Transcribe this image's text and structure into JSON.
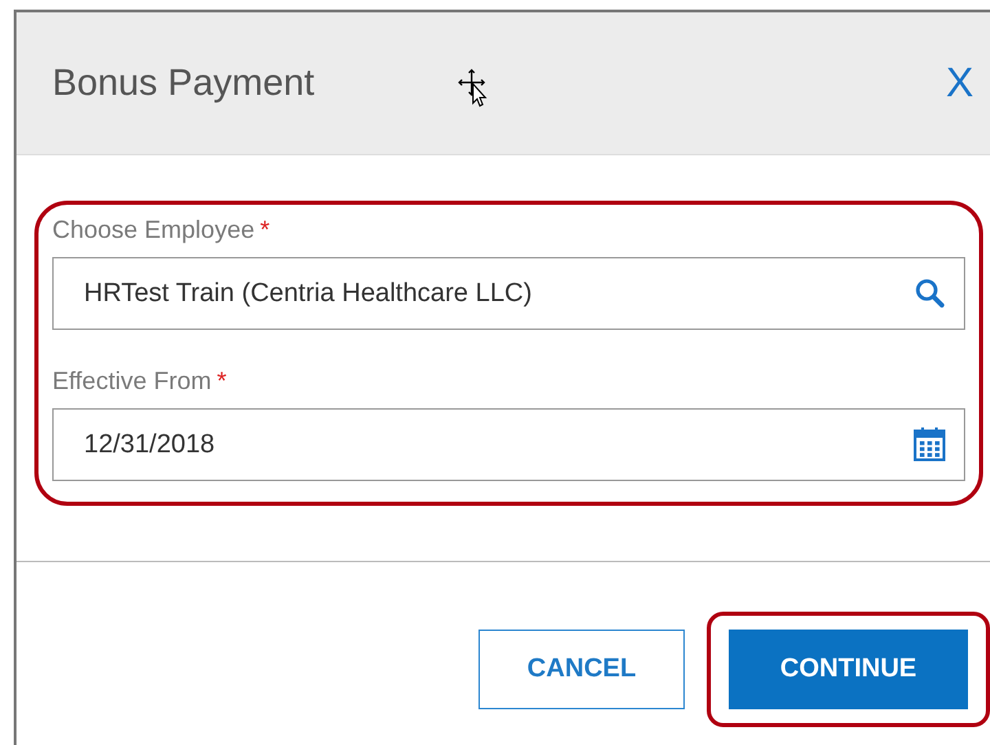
{
  "dialog": {
    "title": "Bonus Payment",
    "close_label": "X"
  },
  "form": {
    "highlighted": true,
    "fields": [
      {
        "kind": "search",
        "label": "Choose Employee",
        "required_mark": "*",
        "value": "HRTest Train (Centria Healthcare LLC)"
      },
      {
        "kind": "date",
        "label": "Effective From",
        "required_mark": "*",
        "value": "12/31/2018"
      }
    ]
  },
  "buttons": [
    {
      "kind": "secondary",
      "label": "CANCEL",
      "highlighted": false
    },
    {
      "kind": "primary",
      "label": "CONTINUE",
      "highlighted": true
    }
  ]
}
